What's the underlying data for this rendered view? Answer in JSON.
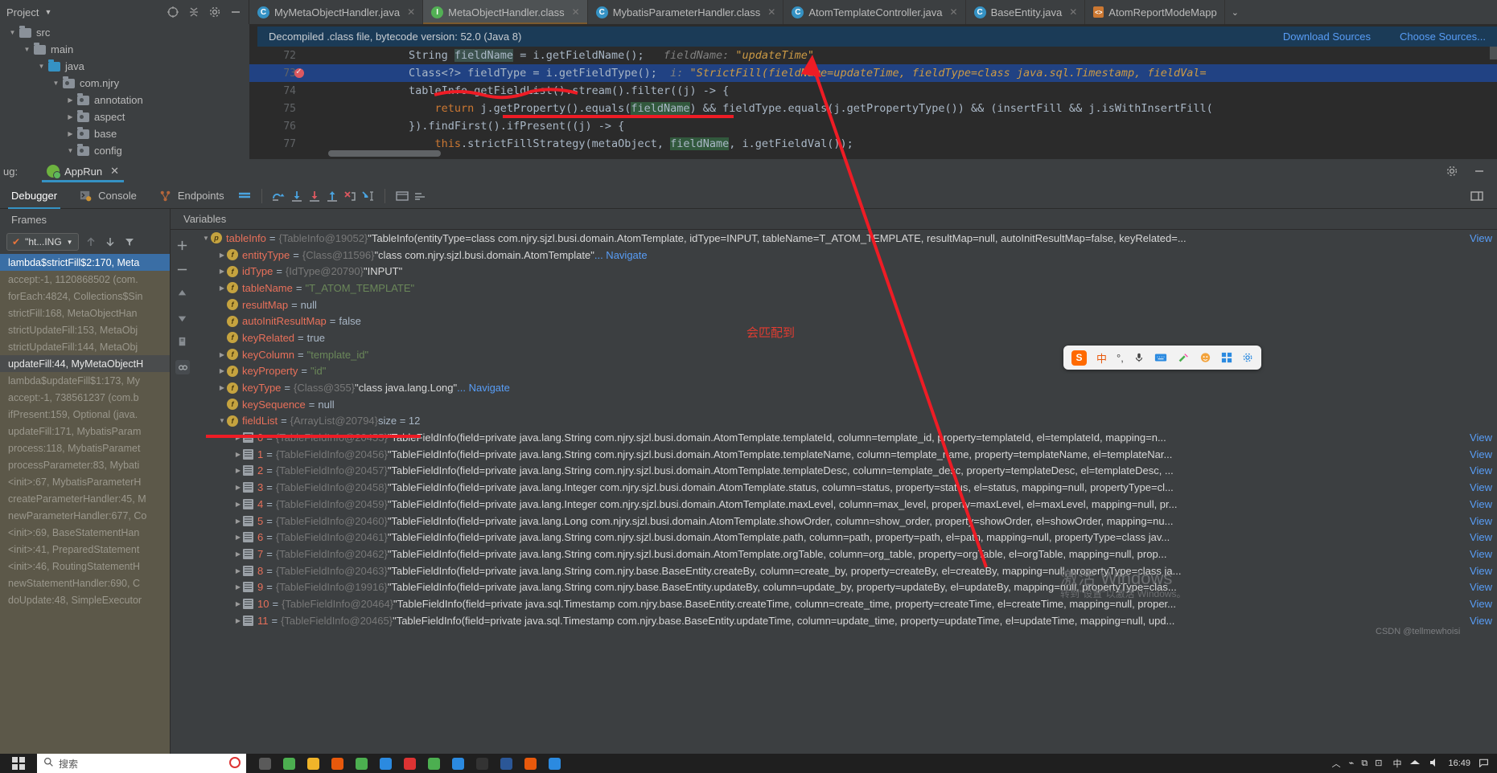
{
  "project": {
    "title": "Project",
    "icons": [
      "locate-icon",
      "collapse-all-icon",
      "settings-icon",
      "minimize-icon"
    ],
    "tree": [
      {
        "label": "src",
        "depth": 0,
        "expanded": true,
        "kind": "folder"
      },
      {
        "label": "main",
        "depth": 1,
        "expanded": true,
        "kind": "folder"
      },
      {
        "label": "java",
        "depth": 2,
        "expanded": true,
        "kind": "source-folder"
      },
      {
        "label": "com.njry",
        "depth": 3,
        "expanded": true,
        "kind": "package"
      },
      {
        "label": "annotation",
        "depth": 4,
        "expanded": false,
        "kind": "package"
      },
      {
        "label": "aspect",
        "depth": 4,
        "expanded": false,
        "kind": "package"
      },
      {
        "label": "base",
        "depth": 4,
        "expanded": false,
        "kind": "package"
      },
      {
        "label": "config",
        "depth": 4,
        "expanded": true,
        "kind": "package"
      }
    ]
  },
  "editor_tabs": [
    {
      "label": "MyMetaObjectHandler.java",
      "icon": "class-icon",
      "active": false
    },
    {
      "label": "MetaObjectHandler.class",
      "icon": "interface-icon",
      "active": true
    },
    {
      "label": "MybatisParameterHandler.class",
      "icon": "class-icon",
      "active": false
    },
    {
      "label": "AtomTemplateController.java",
      "icon": "class-icon",
      "active": false
    },
    {
      "label": "BaseEntity.java",
      "icon": "class-icon",
      "active": false
    },
    {
      "label": "AtomReportModeMapp",
      "icon": "xml-icon",
      "active": false
    }
  ],
  "tab_overflow_icon": "chevron-down-icon",
  "notice": {
    "text": "Decompiled .class file, bytecode version: 52.0 (Java 8)",
    "download_link": "Download Sources",
    "choose_link": "Choose Sources..."
  },
  "code_lines": [
    {
      "number": "72",
      "breakpoint": false,
      "highlight": false,
      "segments": [
        {
          "t": "String ",
          "c": "plain"
        },
        {
          "t": "fieldName",
          "c": "hlsoft"
        },
        {
          "t": " = i.getFieldName();",
          "c": "plain"
        },
        {
          "t": "   fieldName:",
          "c": "hint"
        },
        {
          "t": " \"updateTime\"",
          "c": "hintval"
        }
      ]
    },
    {
      "number": "73",
      "breakpoint": true,
      "highlight": true,
      "segments": [
        {
          "t": "Class<?> fieldType = i.getFieldType();",
          "c": "plain"
        },
        {
          "t": "  i:",
          "c": "hint"
        },
        {
          "t": " \"StrictFill(fieldName=updateTime, fieldType=class java.sql.Timestamp, fieldVal=",
          "c": "hintval"
        }
      ]
    },
    {
      "number": "74",
      "breakpoint": false,
      "highlight": false,
      "segments": [
        {
          "t": "tableInfo.getFieldList().stream().filter((j) -> {",
          "c": "plain"
        }
      ]
    },
    {
      "number": "75",
      "breakpoint": false,
      "highlight": false,
      "indent": true,
      "segments": [
        {
          "t": "    ",
          "c": "plain"
        },
        {
          "t": "return",
          "c": "kw"
        },
        {
          "t": " j.getProperty().equals(",
          "c": "plain"
        },
        {
          "t": "fieldName",
          "c": "sel"
        },
        {
          "t": ") && fieldType.equals(j.getPropertyType()) && (insertFill && j.isWithInsertFill(",
          "c": "plain"
        }
      ]
    },
    {
      "number": "76",
      "breakpoint": false,
      "highlight": false,
      "segments": [
        {
          "t": "}).findFirst().ifPresent((j) -> {",
          "c": "plain"
        }
      ]
    },
    {
      "number": "77",
      "breakpoint": false,
      "highlight": false,
      "segments": [
        {
          "t": "    ",
          "c": "plain"
        },
        {
          "t": "this",
          "c": "kw"
        },
        {
          "t": ".strictFillStrategy(metaObject, ",
          "c": "plain"
        },
        {
          "t": "fieldName",
          "c": "sel"
        },
        {
          "t": ", i.getFieldVal());",
          "c": "plain"
        }
      ]
    }
  ],
  "debug": {
    "label": "ug:",
    "run_config": "AppRun",
    "tabs": [
      {
        "label": "Debugger",
        "icon": "debugger-icon",
        "active": true
      },
      {
        "label": "Console",
        "icon": "console-icon",
        "active": false
      },
      {
        "label": "Endpoints",
        "icon": "endpoints-icon",
        "active": false
      }
    ],
    "toolbar_icons": [
      "layout-icon",
      "step-over-icon",
      "step-into-icon",
      "force-step-into-icon",
      "step-out-icon",
      "drop-frame-icon",
      "run-to-cursor-icon",
      "evaluate-icon",
      "mute-icon"
    ],
    "settings_icon": "gear-icon",
    "minimize_icon": "minimize-icon",
    "layout_icon": "layout-settings-icon"
  },
  "frames": {
    "title": "Frames",
    "thread_selector": "\"ht...ING",
    "up_icon": "arrow-up-icon",
    "down_icon": "arrow-down-icon",
    "filter_icon": "filter-icon",
    "items": [
      {
        "label": "lambda$strictFill$2:170, Meta",
        "state": "selected"
      },
      {
        "label": "accept:-1, 1120868502 (com.",
        "state": "normal"
      },
      {
        "label": "forEach:4824, Collections$Sin",
        "state": "normal"
      },
      {
        "label": "strictFill:168, MetaObjectHan",
        "state": "normal"
      },
      {
        "label": "strictUpdateFill:153, MetaObj",
        "state": "normal"
      },
      {
        "label": "strictUpdateFill:144, MetaObj",
        "state": "normal"
      },
      {
        "label": "updateFill:44, MyMetaObjectH",
        "state": "current"
      },
      {
        "label": "lambda$updateFill$1:173, My",
        "state": "normal"
      },
      {
        "label": "accept:-1, 738561237 (com.b",
        "state": "normal"
      },
      {
        "label": "ifPresent:159, Optional (java.",
        "state": "normal"
      },
      {
        "label": "updateFill:171, MybatisParam",
        "state": "normal"
      },
      {
        "label": "process:118, MybatisParamet",
        "state": "normal"
      },
      {
        "label": "processParameter:83, Mybati",
        "state": "normal"
      },
      {
        "label": "<init>:67, MybatisParameterH",
        "state": "normal"
      },
      {
        "label": "createParameterHandler:45, M",
        "state": "normal"
      },
      {
        "label": "newParameterHandler:677, Co",
        "state": "normal"
      },
      {
        "label": "<init>:69, BaseStatementHan",
        "state": "normal"
      },
      {
        "label": "<init>:41, PreparedStatement",
        "state": "normal"
      },
      {
        "label": "<init>:46, RoutingStatementH",
        "state": "normal"
      },
      {
        "label": "newStatementHandler:690, C",
        "state": "normal"
      },
      {
        "label": "doUpdate:48, SimpleExecutor",
        "state": "normal"
      }
    ]
  },
  "variables": {
    "title": "Variables",
    "side_icons": [
      "add-icon",
      "remove-icon",
      "move-up-icon",
      "move-down-icon",
      "copy-icon",
      "inspect-icon"
    ],
    "rows": [
      {
        "indent": 0,
        "arrow": "expanded",
        "icon": "p",
        "name": "tableInfo",
        "value": "{TableInfo@19052}",
        "desc": "\"TableInfo(entityType=class com.njry.sjzl.busi.domain.AtomTemplate, idType=INPUT, tableName=T_ATOM_TEMPLATE, resultMap=null, autoInitResultMap=false, keyRelated=...",
        "tail": "View"
      },
      {
        "indent": 1,
        "arrow": "collapsed",
        "icon": "f",
        "name": "entityType",
        "value": "{Class@11596}",
        "desc": "\"class com.njry.sjzl.busi.domain.AtomTemplate\"",
        "nav": "... Navigate"
      },
      {
        "indent": 1,
        "arrow": "collapsed",
        "icon": "f",
        "name": "idType",
        "value": "{IdType@20790}",
        "desc": "\"INPUT\""
      },
      {
        "indent": 1,
        "arrow": "collapsed",
        "icon": "f",
        "name": "tableName",
        "str": "\"T_ATOM_TEMPLATE\""
      },
      {
        "indent": 1,
        "arrow": "none",
        "icon": "f",
        "name": "resultMap",
        "lit": "null"
      },
      {
        "indent": 1,
        "arrow": "none",
        "icon": "f",
        "name": "autoInitResultMap",
        "lit": "false"
      },
      {
        "indent": 1,
        "arrow": "none",
        "icon": "f",
        "name": "keyRelated",
        "lit": "true"
      },
      {
        "indent": 1,
        "arrow": "collapsed",
        "icon": "f",
        "name": "keyColumn",
        "str": "\"template_id\""
      },
      {
        "indent": 1,
        "arrow": "collapsed",
        "icon": "f",
        "name": "keyProperty",
        "str": "\"id\""
      },
      {
        "indent": 1,
        "arrow": "collapsed",
        "icon": "f",
        "name": "keyType",
        "value": "{Class@355}",
        "desc": "\"class java.lang.Long\"",
        "nav": "... Navigate"
      },
      {
        "indent": 1,
        "arrow": "none",
        "icon": "f",
        "name": "keySequence",
        "lit": "null"
      },
      {
        "indent": 1,
        "arrow": "expanded",
        "icon": "f",
        "name": "fieldList",
        "value": "{ArrayList@20794}",
        "size": "size = 12"
      },
      {
        "indent": 2,
        "arrow": "collapsed",
        "icon": "list",
        "name": "0",
        "value": "{TableFieldInfo@20455}",
        "desc": "\"TableFieldInfo(field=private java.lang.String com.njry.sjzl.busi.domain.AtomTemplate.templateId, column=template_id, property=templateId, el=templateId, mapping=n...",
        "tail": "View"
      },
      {
        "indent": 2,
        "arrow": "collapsed",
        "icon": "list",
        "name": "1",
        "value": "{TableFieldInfo@20456}",
        "desc": "\"TableFieldInfo(field=private java.lang.String com.njry.sjzl.busi.domain.AtomTemplate.templateName, column=template_name, property=templateName, el=templateNar...",
        "tail": "View"
      },
      {
        "indent": 2,
        "arrow": "collapsed",
        "icon": "list",
        "name": "2",
        "value": "{TableFieldInfo@20457}",
        "desc": "\"TableFieldInfo(field=private java.lang.String com.njry.sjzl.busi.domain.AtomTemplate.templateDesc, column=template_desc, property=templateDesc, el=templateDesc, ...",
        "tail": "View"
      },
      {
        "indent": 2,
        "arrow": "collapsed",
        "icon": "list",
        "name": "3",
        "value": "{TableFieldInfo@20458}",
        "desc": "\"TableFieldInfo(field=private java.lang.Integer com.njry.sjzl.busi.domain.AtomTemplate.status, column=status, property=status, el=status, mapping=null, propertyType=cl...",
        "tail": "View"
      },
      {
        "indent": 2,
        "arrow": "collapsed",
        "icon": "list",
        "name": "4",
        "value": "{TableFieldInfo@20459}",
        "desc": "\"TableFieldInfo(field=private java.lang.Integer com.njry.sjzl.busi.domain.AtomTemplate.maxLevel, column=max_level, property=maxLevel, el=maxLevel, mapping=null, pr...",
        "tail": "View"
      },
      {
        "indent": 2,
        "arrow": "collapsed",
        "icon": "list",
        "name": "5",
        "value": "{TableFieldInfo@20460}",
        "desc": "\"TableFieldInfo(field=private java.lang.Long com.njry.sjzl.busi.domain.AtomTemplate.showOrder, column=show_order, property=showOrder, el=showOrder, mapping=nu...",
        "tail": "View"
      },
      {
        "indent": 2,
        "arrow": "collapsed",
        "icon": "list",
        "name": "6",
        "value": "{TableFieldInfo@20461}",
        "desc": "\"TableFieldInfo(field=private java.lang.String com.njry.sjzl.busi.domain.AtomTemplate.path, column=path, property=path, el=path, mapping=null, propertyType=class jav...",
        "tail": "View"
      },
      {
        "indent": 2,
        "arrow": "collapsed",
        "icon": "list",
        "name": "7",
        "value": "{TableFieldInfo@20462}",
        "desc": "\"TableFieldInfo(field=private java.lang.String com.njry.sjzl.busi.domain.AtomTemplate.orgTable, column=org_table, property=orgTable, el=orgTable, mapping=null, prop...",
        "tail": "View"
      },
      {
        "indent": 2,
        "arrow": "collapsed",
        "icon": "list",
        "name": "8",
        "value": "{TableFieldInfo@20463}",
        "desc": "\"TableFieldInfo(field=private java.lang.String com.njry.base.BaseEntity.createBy, column=create_by, property=createBy, el=createBy, mapping=null, propertyType=class ja...",
        "tail": "View"
      },
      {
        "indent": 2,
        "arrow": "collapsed",
        "icon": "list",
        "name": "9",
        "value": "{TableFieldInfo@19916}",
        "desc": "\"TableFieldInfo(field=private java.lang.String com.njry.base.BaseEntity.updateBy, column=update_by, property=updateBy, el=updateBy, mapping=null, propertyType=clas...",
        "tail": "View"
      },
      {
        "indent": 2,
        "arrow": "collapsed",
        "icon": "list",
        "name": "10",
        "value": "{TableFieldInfo@20464}",
        "desc": "\"TableFieldInfo(field=private java.sql.Timestamp com.njry.base.BaseEntity.createTime, column=create_time, property=createTime, el=createTime, mapping=null, proper...",
        "tail": "View"
      },
      {
        "indent": 2,
        "arrow": "collapsed",
        "icon": "list",
        "name": "11",
        "value": "{TableFieldInfo@20465}",
        "desc": "\"TableFieldInfo(field=private java.sql.Timestamp com.njry.base.BaseEntity.updateTime, column=update_time, property=updateTime, el=updateTime, mapping=null, upd...",
        "tail": "View"
      }
    ]
  },
  "annotations": {
    "note_text": "会匹配到",
    "note_color": "#e03c31",
    "arrow_color": "#ee1c25",
    "underline_color": "#ee1c25"
  },
  "watermark": {
    "line1": "激活 Windows",
    "line2": "转到\"设置\"以激活 Windows。",
    "handle": "CSDN @tellmewhoisi"
  },
  "ime_bar": {
    "logo": "S",
    "items": [
      "中",
      "°,",
      "mic-icon",
      "keyboard-icon",
      "tools-icon",
      "emoji-icon",
      "apps-icon",
      "settings-icon"
    ]
  },
  "taskbar": {
    "start_icon": "windows-start-icon",
    "search_placeholder": "搜索",
    "search_icon": "search-icon",
    "apps": [
      "task-view-icon",
      "chrome-icon",
      "folder-icon",
      "idea-icon",
      "wechat-icon",
      "navicat-icon",
      "redis-icon",
      "chrome2-icon",
      "edge-icon",
      "lock-icon",
      "word-icon",
      "chrome3-icon",
      "app-icon"
    ],
    "time": "16:49",
    "tray": [
      "up-arrow-icon",
      "network-icon",
      "volume-icon",
      "ime-icon"
    ]
  }
}
